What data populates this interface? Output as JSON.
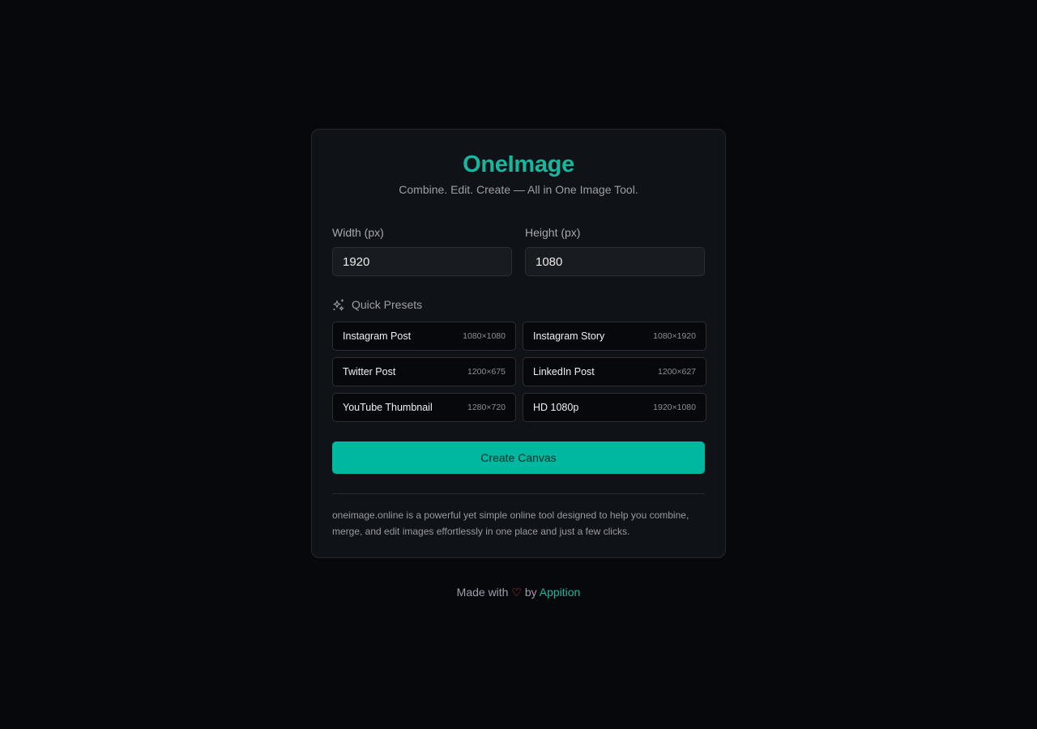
{
  "brand": {
    "title": "OneImage",
    "tagline": "Combine. Edit. Create — All in One Image Tool."
  },
  "dimensions": {
    "width_label": "Width (px)",
    "width_value": "1920",
    "height_label": "Height (px)",
    "height_value": "1080"
  },
  "presets": {
    "title": "Quick Presets",
    "icon": "sparkles-icon",
    "items": [
      {
        "name": "Instagram Post",
        "size": "1080×1080"
      },
      {
        "name": "Instagram Story",
        "size": "1080×1920"
      },
      {
        "name": "Twitter Post",
        "size": "1200×675"
      },
      {
        "name": "LinkedIn Post",
        "size": "1200×627"
      },
      {
        "name": "YouTube Thumbnail",
        "size": "1280×720"
      },
      {
        "name": "HD 1080p",
        "size": "1920×1080"
      }
    ]
  },
  "actions": {
    "create_label": "Create Canvas"
  },
  "description": "oneimage.online is a powerful yet simple online tool designed to help you combine, merge, and edit images effortlessly in one place and just a few clicks.",
  "footer": {
    "prefix": "Made with",
    "heart": "♡",
    "by": "by",
    "link": "Appition"
  },
  "colors": {
    "accent": "#17b79e",
    "button": "#00b8a0",
    "background": "#07080c",
    "card": "#0f1216",
    "heart": "#e0434b"
  }
}
